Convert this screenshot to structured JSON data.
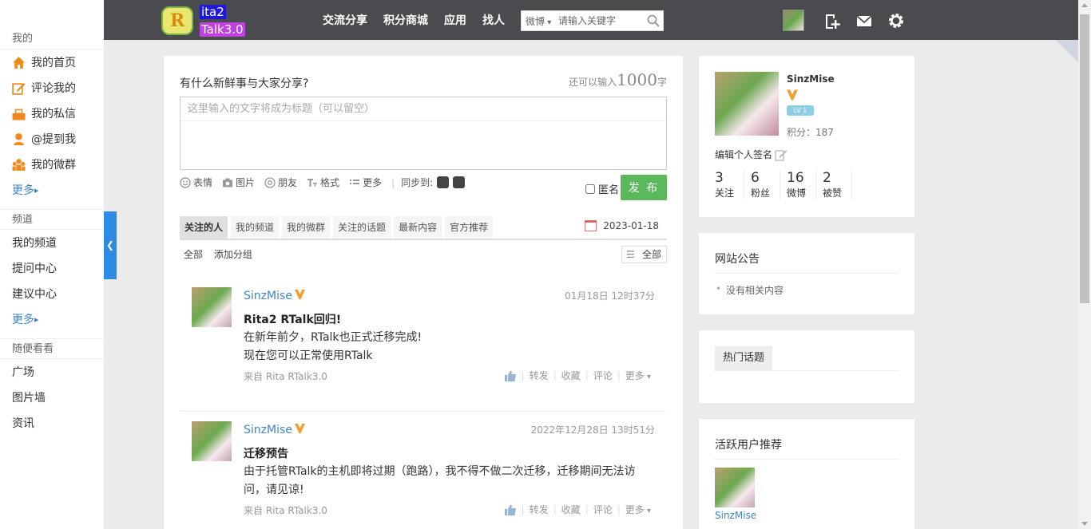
{
  "header": {
    "logo_line1": "ita2",
    "logo_line2": "Talk3.0",
    "logo_badge": "R",
    "nav": [
      "交流分享",
      "积分商城",
      "应用",
      "找人"
    ],
    "search_type": "微博",
    "search_placeholder": "请输入关键字"
  },
  "sidebar": {
    "sections": [
      {
        "title": "我的",
        "items": [
          "我的首页",
          "评论我的",
          "我的私信",
          "@提到我",
          "我的微群"
        ],
        "more": "更多"
      },
      {
        "title": "频道",
        "items": [
          "我的频道",
          "提问中心",
          "建议中心"
        ],
        "more": "更多"
      },
      {
        "title": "随便看看",
        "items": [
          "广场",
          "图片墙",
          "资讯"
        ]
      }
    ]
  },
  "publisher": {
    "prompt": "有什么新鲜事与大家分享?",
    "count_prefix": "还可以输入",
    "count": "1000",
    "count_suffix": "字",
    "title_placeholder": "这里输入的文字将成为标题（可以留空）",
    "tools": [
      "表情",
      "图片",
      "朋友",
      "格式",
      "更多"
    ],
    "sync_label": "同步到:",
    "anon_label": "匿名",
    "submit": "发 布"
  },
  "feed": {
    "tabs": [
      "关注的人",
      "我的频道",
      "我的微群",
      "关注的话题",
      "最新内容",
      "官方推荐"
    ],
    "date": "2023-01-18",
    "groups": [
      "全部",
      "添加分组"
    ],
    "group_filter": "全部",
    "actions": {
      "repost": "转发",
      "fav": "收藏",
      "comment": "评论",
      "more": "更多"
    },
    "posts": [
      {
        "user": "SinzMise",
        "time": "01月18日 12时37分",
        "title": "Rita2 RTalk回归!",
        "body": [
          "在新年前夕，RTalk也正式迁移完成!",
          "现在您可以正常使用RTalk"
        ],
        "from": "来自 Rita RTalk3.0"
      },
      {
        "user": "SinzMise",
        "time": "2022年12月28日 13时51分",
        "title": "迁移预告",
        "body": [
          "由于托管RTalk的主机即将过期（跑路），我不得不做二次迁移，迁移期间无法访问，请见谅!"
        ],
        "from": "来自 Rita RTalk3.0"
      }
    ]
  },
  "profile": {
    "name": "SinzMise",
    "level": "LV 1",
    "score": "积分：187",
    "signature": "编辑个人签名",
    "stats": [
      {
        "num": "3",
        "label": "关注"
      },
      {
        "num": "6",
        "label": "粉丝"
      },
      {
        "num": "16",
        "label": "微博"
      },
      {
        "num": "2",
        "label": "被赞"
      }
    ]
  },
  "notice": {
    "title": "网站公告",
    "empty": "没有相关内容"
  },
  "hot": {
    "title": "热门话题"
  },
  "active_users": {
    "title": "活跃用户推荐",
    "users": [
      "SinzMise"
    ]
  },
  "colors": {
    "topbar": "#4a4b4f",
    "link": "#3f86c8",
    "publish": "#5cb85c",
    "side_toggle": "#2d8be6"
  }
}
